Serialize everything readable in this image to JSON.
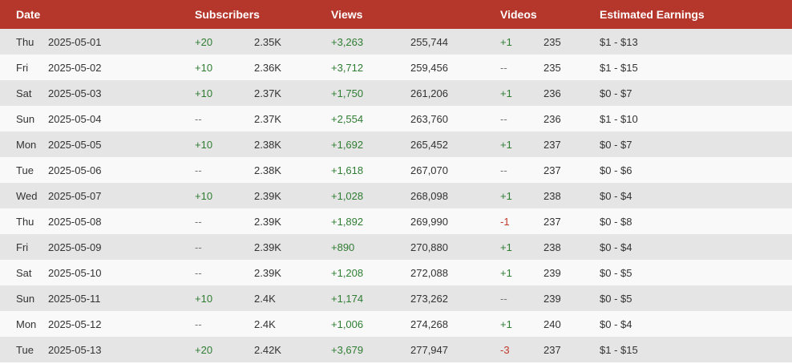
{
  "header": {
    "date": "Date",
    "subscribers": "Subscribers",
    "views": "Views",
    "videos": "Videos",
    "earnings": "Estimated Earnings"
  },
  "rows": [
    {
      "day": "Thu",
      "date": "2025-05-01",
      "sub_delta": "+20",
      "sub_total": "2.35K",
      "view_delta": "+3,263",
      "view_total": "255,744",
      "video_delta": "+1",
      "video_total": "235",
      "earnings": "$1 - $13"
    },
    {
      "day": "Fri",
      "date": "2025-05-02",
      "sub_delta": "+10",
      "sub_total": "2.36K",
      "view_delta": "+3,712",
      "view_total": "259,456",
      "video_delta": "--",
      "video_total": "235",
      "earnings": "$1 - $15"
    },
    {
      "day": "Sat",
      "date": "2025-05-03",
      "sub_delta": "+10",
      "sub_total": "2.37K",
      "view_delta": "+1,750",
      "view_total": "261,206",
      "video_delta": "+1",
      "video_total": "236",
      "earnings": "$0 - $7"
    },
    {
      "day": "Sun",
      "date": "2025-05-04",
      "sub_delta": "--",
      "sub_total": "2.37K",
      "view_delta": "+2,554",
      "view_total": "263,760",
      "video_delta": "--",
      "video_total": "236",
      "earnings": "$1 - $10"
    },
    {
      "day": "Mon",
      "date": "2025-05-05",
      "sub_delta": "+10",
      "sub_total": "2.38K",
      "view_delta": "+1,692",
      "view_total": "265,452",
      "video_delta": "+1",
      "video_total": "237",
      "earnings": "$0 - $7"
    },
    {
      "day": "Tue",
      "date": "2025-05-06",
      "sub_delta": "--",
      "sub_total": "2.38K",
      "view_delta": "+1,618",
      "view_total": "267,070",
      "video_delta": "--",
      "video_total": "237",
      "earnings": "$0 - $6"
    },
    {
      "day": "Wed",
      "date": "2025-05-07",
      "sub_delta": "+10",
      "sub_total": "2.39K",
      "view_delta": "+1,028",
      "view_total": "268,098",
      "video_delta": "+1",
      "video_total": "238",
      "earnings": "$0 - $4"
    },
    {
      "day": "Thu",
      "date": "2025-05-08",
      "sub_delta": "--",
      "sub_total": "2.39K",
      "view_delta": "+1,892",
      "view_total": "269,990",
      "video_delta": "-1",
      "video_total": "237",
      "earnings": "$0 - $8"
    },
    {
      "day": "Fri",
      "date": "2025-05-09",
      "sub_delta": "--",
      "sub_total": "2.39K",
      "view_delta": "+890",
      "view_total": "270,880",
      "video_delta": "+1",
      "video_total": "238",
      "earnings": "$0 - $4"
    },
    {
      "day": "Sat",
      "date": "2025-05-10",
      "sub_delta": "--",
      "sub_total": "2.39K",
      "view_delta": "+1,208",
      "view_total": "272,088",
      "video_delta": "+1",
      "video_total": "239",
      "earnings": "$0 - $5"
    },
    {
      "day": "Sun",
      "date": "2025-05-11",
      "sub_delta": "+10",
      "sub_total": "2.4K",
      "view_delta": "+1,174",
      "view_total": "273,262",
      "video_delta": "--",
      "video_total": "239",
      "earnings": "$0 - $5"
    },
    {
      "day": "Mon",
      "date": "2025-05-12",
      "sub_delta": "--",
      "sub_total": "2.4K",
      "view_delta": "+1,006",
      "view_total": "274,268",
      "video_delta": "+1",
      "video_total": "240",
      "earnings": "$0 - $4"
    },
    {
      "day": "Tue",
      "date": "2025-05-13",
      "sub_delta": "+20",
      "sub_total": "2.42K",
      "view_delta": "+3,679",
      "view_total": "277,947",
      "video_delta": "-3",
      "video_total": "237",
      "earnings": "$1 - $15"
    }
  ],
  "colors": {
    "header_bg": "#b5372c",
    "positive": "#2e7d32",
    "negative": "#c0392b",
    "neutral": "#777777"
  }
}
